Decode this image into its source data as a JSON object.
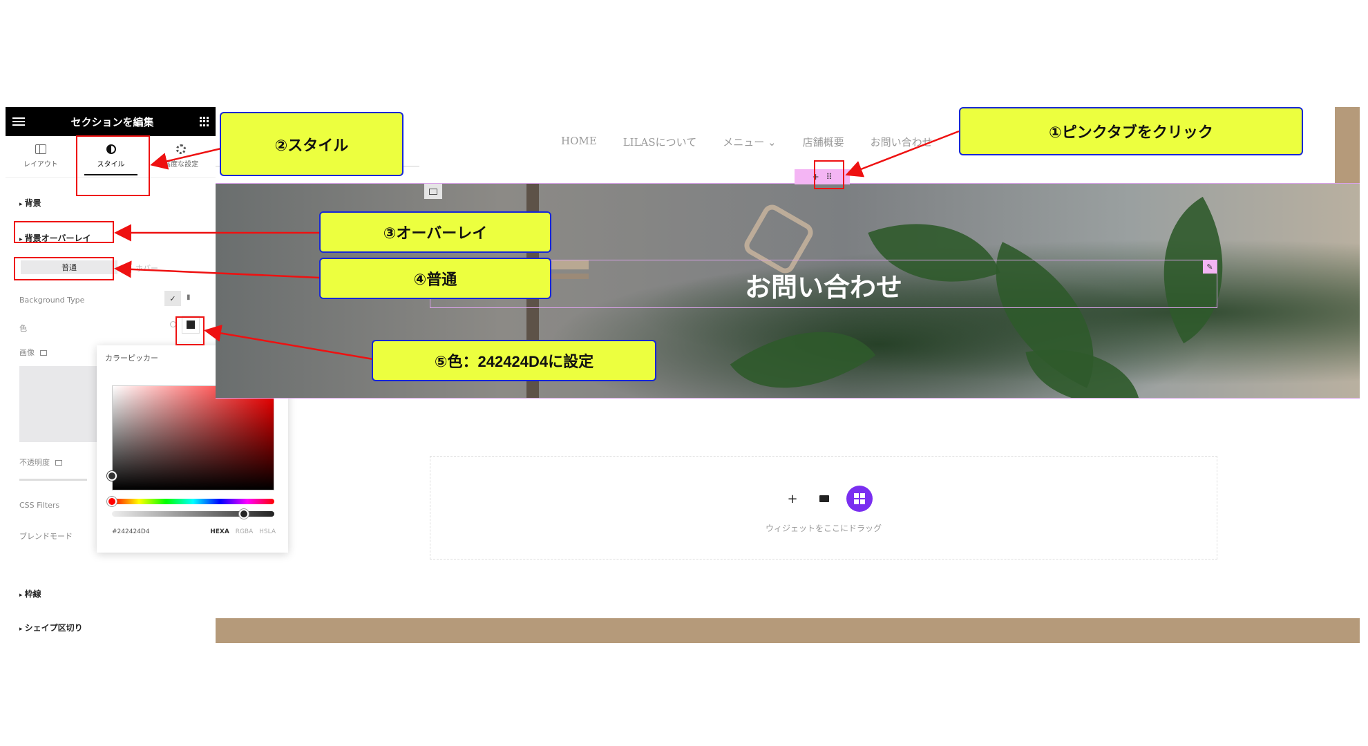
{
  "panel": {
    "title": "セクションを編集",
    "tabs": [
      {
        "label": "レイアウト"
      },
      {
        "label": "スタイル"
      },
      {
        "label": "高度な設定"
      }
    ],
    "sections": {
      "background": "背景",
      "overlay": "背景オーバーレイ",
      "border": "枠線",
      "shape_divider": "シェイプ区切り"
    },
    "overlay_tabs": {
      "normal": "普通",
      "hover": "ホバー"
    },
    "fields": {
      "background_type": "Background Type",
      "color": "色",
      "image": "画像",
      "opacity": "不透明度",
      "css_filters": "CSS Filters",
      "blend_mode": "ブレンドモード"
    }
  },
  "color_picker": {
    "title": "カラーピッカー",
    "hex_value": "#242424D4",
    "modes": [
      "HEXA",
      "RGBA",
      "HSLA"
    ],
    "active_mode": "HEXA",
    "selected_color": "#242424"
  },
  "site": {
    "nav": [
      "HOME",
      "LILASについて",
      "メニュー",
      "店舗概要",
      "お問い合わせ"
    ],
    "hero_title": "お問い合わせ",
    "dropzone_text": "ウィジェットをここにドラッグ"
  },
  "annotations": {
    "step1": "①ピンクタブをクリック",
    "step2": "②スタイル",
    "step3": "③オーバーレイ",
    "step4": "④普通",
    "step5": "⑤色：242424D4に設定"
  },
  "colors": {
    "callout_fill": "#ecff3f",
    "callout_border": "#1627d6",
    "highlight_red": "#ee1111",
    "accent_purple": "#7a2ff0",
    "handle_pink": "#f4b5f4",
    "brown": "#b59a7a"
  }
}
